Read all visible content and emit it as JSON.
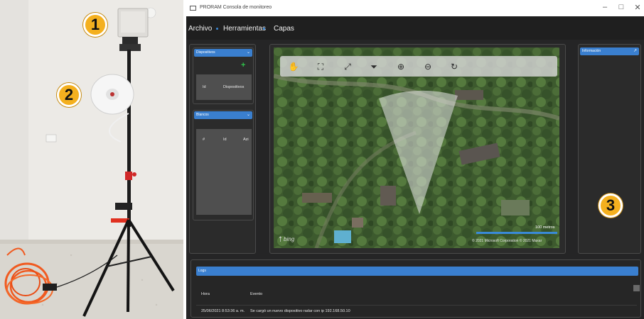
{
  "callouts": [
    "1",
    "2",
    "3"
  ],
  "window": {
    "title": "PRORAM Consola de monitoreo",
    "minimize": "–",
    "maximize": "□",
    "close": "✕"
  },
  "menu": [
    "Archivo",
    "Herramientas",
    "Capas"
  ],
  "devices_panel": {
    "header": "Dispositivos",
    "add_icon": "+",
    "columns": [
      "Id",
      "Dispositivos"
    ]
  },
  "targets_panel": {
    "header": "Blancos",
    "columns": [
      "#",
      "Id",
      "Azi"
    ]
  },
  "info_panel": {
    "header": "Información"
  },
  "map": {
    "scale_label": "100 metros",
    "attribution": "© 2021 Microsoft Corporation   © 2021 Maxar",
    "provider": "bing",
    "tools": [
      "pan-icon",
      "fit-extent-icon",
      "expand-icon",
      "eraser-icon",
      "zoom-in-icon",
      "zoom-out-icon",
      "refresh-icon"
    ]
  },
  "logs": {
    "header": "Logs",
    "columns": [
      "Hora",
      "Evento"
    ],
    "rows": [
      {
        "time": "25/06/2021 8:53:36 a. m.",
        "event": "Se cargó un nuevo dispositivo radar con ip 192.168.50.10"
      }
    ]
  },
  "colors": {
    "accent": "#3a7fcf",
    "callout": "#f4b01f",
    "background": "#252526"
  }
}
